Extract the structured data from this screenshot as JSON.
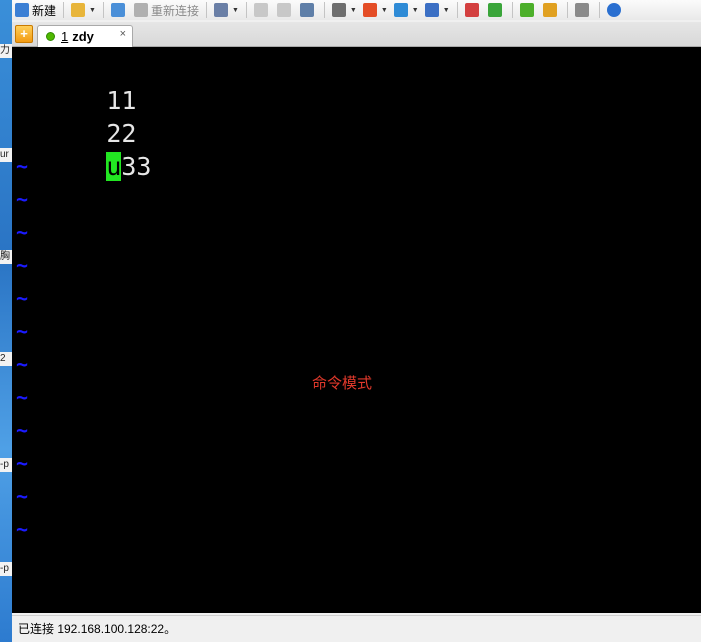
{
  "desktop": {
    "fragments": [
      "力",
      "ur",
      "胸",
      "2",
      "-p",
      "-p"
    ]
  },
  "toolbar": {
    "new_label": "新建",
    "reconnect_label": "重新连接",
    "icons": [
      {
        "name": "new-session-icon",
        "color": "#3b7fd4"
      },
      {
        "name": "open-folder-icon",
        "color": "#e8b53a"
      },
      {
        "name": "link-icon",
        "color": "#4a8fd8"
      },
      {
        "name": "reconnect-icon",
        "color": "#b0b0b0"
      },
      {
        "name": "properties-icon",
        "color": "#6a7fa6"
      },
      {
        "name": "copy-icon",
        "color": "#c8c8c8"
      },
      {
        "name": "paste-icon",
        "color": "#c8c8c8"
      },
      {
        "name": "find-icon",
        "color": "#5f7fa8"
      },
      {
        "name": "print-icon",
        "color": "#6e6e6e"
      },
      {
        "name": "color-scheme-icon",
        "color": "#e44d26"
      },
      {
        "name": "globe-icon",
        "color": "#2e8bd6"
      },
      {
        "name": "font-icon",
        "color": "#3b6fc4"
      },
      {
        "name": "xftp-icon",
        "color": "#d33f3f"
      },
      {
        "name": "script-icon",
        "color": "#3aa53a"
      },
      {
        "name": "fullscreen-icon",
        "color": "#4caf2a"
      },
      {
        "name": "lock-icon",
        "color": "#e0a020"
      },
      {
        "name": "keyboard-icon",
        "color": "#8a8a8a"
      },
      {
        "name": "help-icon",
        "color": "#2a6fd0"
      }
    ]
  },
  "tabs": {
    "add_symbol": "+",
    "items": [
      {
        "number": "1",
        "title": "zdy",
        "close": "×",
        "status_color": "#4fb800"
      }
    ]
  },
  "terminal": {
    "lines": [
      {
        "cursor": "",
        "text": "11"
      },
      {
        "cursor": "",
        "text": "22"
      },
      {
        "cursor": "u",
        "text": "33"
      }
    ],
    "empty_line_marker": "~",
    "empty_line_count": 12,
    "mode_label": "命令模式",
    "colors": {
      "background": "#000000",
      "text": "#e6e6e6",
      "cursor": "#22e622",
      "tilde": "#1b1bff",
      "mode_label": "#e0392b"
    }
  },
  "statusbar": {
    "text": "已连接 192.168.100.128:22。"
  }
}
